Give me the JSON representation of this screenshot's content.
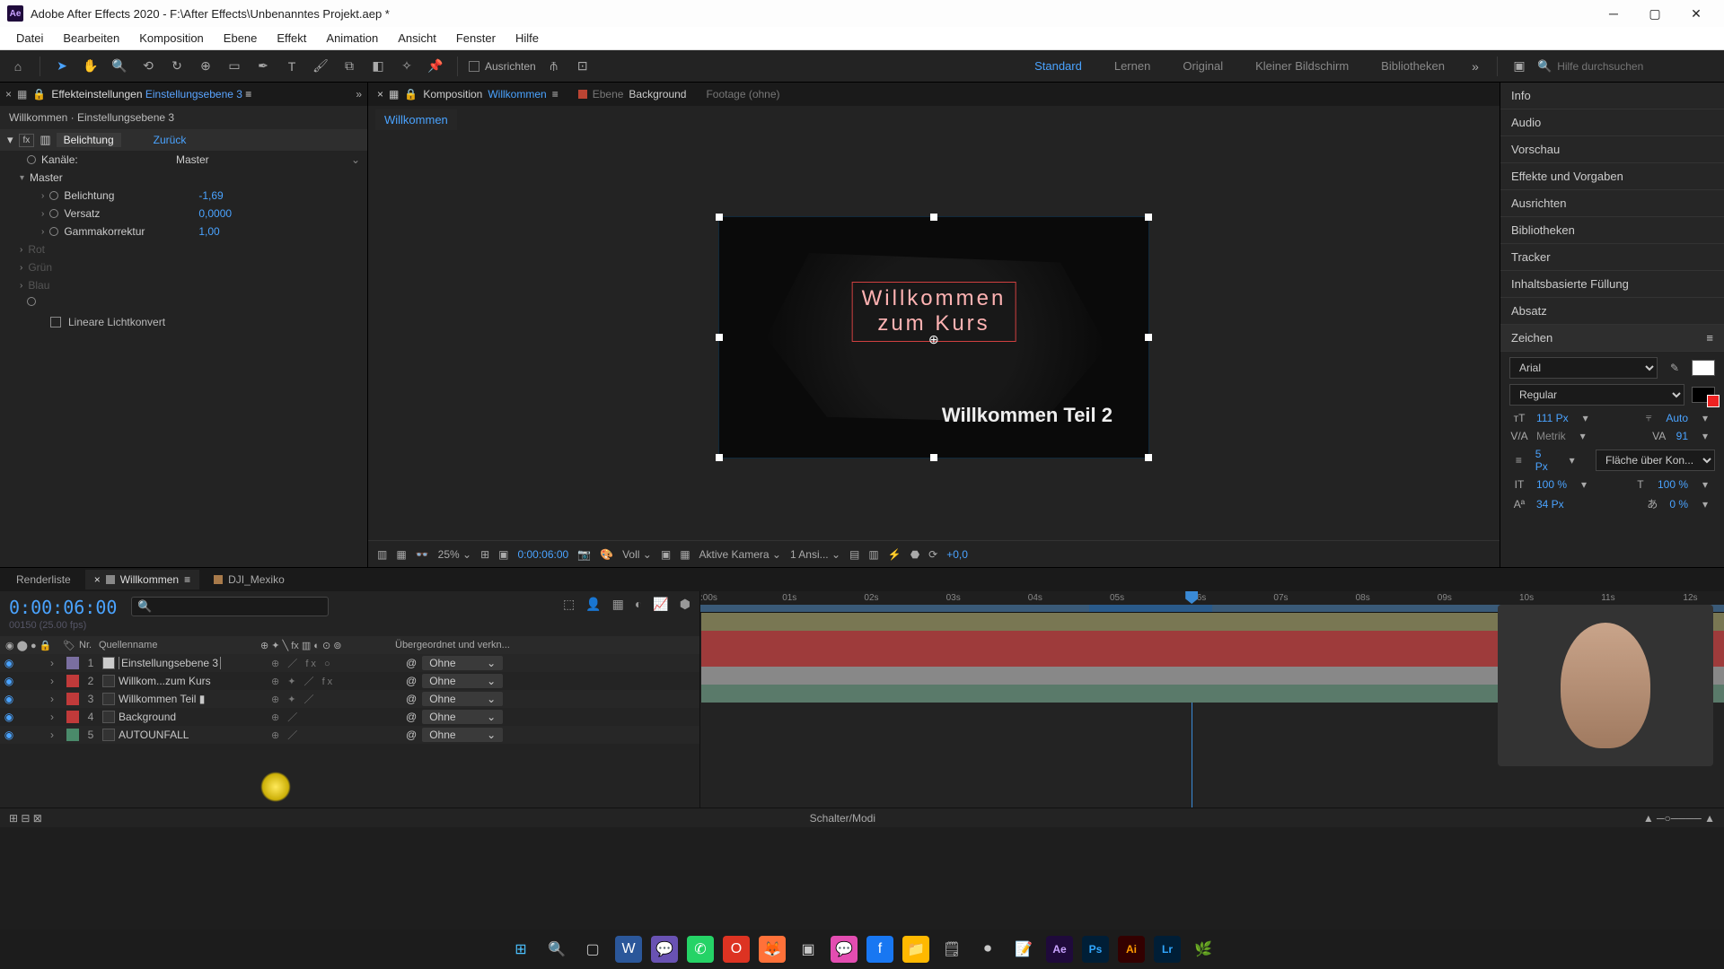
{
  "app": {
    "title": "Adobe After Effects 2020 - F:\\After Effects\\Unbenanntes Projekt.aep *"
  },
  "menu": [
    "Datei",
    "Bearbeiten",
    "Komposition",
    "Ebene",
    "Effekt",
    "Animation",
    "Ansicht",
    "Fenster",
    "Hilfe"
  ],
  "toolbar": {
    "align": "Ausrichten",
    "workspaces": [
      "Standard",
      "Lernen",
      "Original",
      "Kleiner Bildschirm",
      "Bibliotheken"
    ],
    "search_placeholder": "Hilfe durchsuchen"
  },
  "effects_panel": {
    "tab": "Effekteinstellungen",
    "layer_link": "Einstellungsebene 3",
    "path": "Willkommen · Einstellungsebene 3",
    "effect_name": "Belichtung",
    "reset": "Zurück",
    "props": {
      "channels_k": "Kanäle:",
      "channels_v": "Master",
      "master": "Master",
      "exposure_k": "Belichtung",
      "exposure_v": "-1,69",
      "offset_k": "Versatz",
      "offset_v": "0,0000",
      "gamma_k": "Gammakorrektur",
      "gamma_v": "1,00",
      "rot": "Rot",
      "gruen": "Grün",
      "blau": "Blau",
      "linear": "Lineare Lichtkonvert"
    }
  },
  "comp_panel": {
    "prefix": "Komposition",
    "name": "Willkommen",
    "ebene": "Ebene",
    "ebene_name": "Background",
    "footage": "Footage (ohne)",
    "crumb": "Willkommen",
    "text1": "Willkommen\nzum Kurs",
    "text2": "Willkommen Teil 2",
    "viewer": {
      "zoom": "25%",
      "tc": "0:00:06:00",
      "res": "Voll",
      "camera": "Aktive Kamera",
      "views": "1 Ansi...",
      "exp": "+0,0"
    }
  },
  "right_panels": [
    "Info",
    "Audio",
    "Vorschau",
    "Effekte und Vorgaben",
    "Ausrichten",
    "Bibliotheken",
    "Tracker",
    "Inhaltsbasierte Füllung",
    "Absatz"
  ],
  "char_panel": {
    "title": "Zeichen",
    "font": "Arial",
    "style": "Regular",
    "size": "111 Px",
    "leading": "Auto",
    "tracking_metric": "Metrik",
    "tracking_val": "91",
    "stroke": "5 Px",
    "stroke_mode": "Fläche über Kon...",
    "scale_h": "100 %",
    "scale_v": "100 %",
    "baseline": "34 Px",
    "tsume": "0 %"
  },
  "timeline": {
    "tab_render": "Renderliste",
    "tab_comp": "Willkommen",
    "tab_other": "DJI_Mexiko",
    "tc": "0:00:06:00",
    "tc_sub": "00150 (25.00 fps)",
    "col_nr": "Nr.",
    "col_src": "Quellenname",
    "col_parent": "Übergeordnet und verkn...",
    "parent_none": "Ohne",
    "layers": [
      {
        "n": "1",
        "lbl": "#7a6fa0",
        "name": "Einstellungsebene 3",
        "selected": true,
        "m": "⊕   ／ fx        ○"
      },
      {
        "n": "2",
        "lbl": "#c03a3a",
        "name": "Willkom...zum Kurs",
        "selected": false,
        "m": "⊕ ✦ ／ fx"
      },
      {
        "n": "3",
        "lbl": "#c03a3a",
        "name": "Willkommen Teil ▮",
        "selected": false,
        "m": "⊕ ✦ ／"
      },
      {
        "n": "4",
        "lbl": "#c03a3a",
        "name": "Background",
        "selected": false,
        "m": "⊕   ／"
      },
      {
        "n": "5",
        "lbl": "#4a8a6a",
        "name": "AUTOUNFALL",
        "selected": false,
        "m": "⊕   ／"
      }
    ],
    "status": "Schalter/Modi",
    "ticks": [
      ":00s",
      "01s",
      "02s",
      "03s",
      "04s",
      "05s",
      "06s",
      "07s",
      "08s",
      "09s",
      "10s",
      "11s",
      "12s"
    ]
  }
}
